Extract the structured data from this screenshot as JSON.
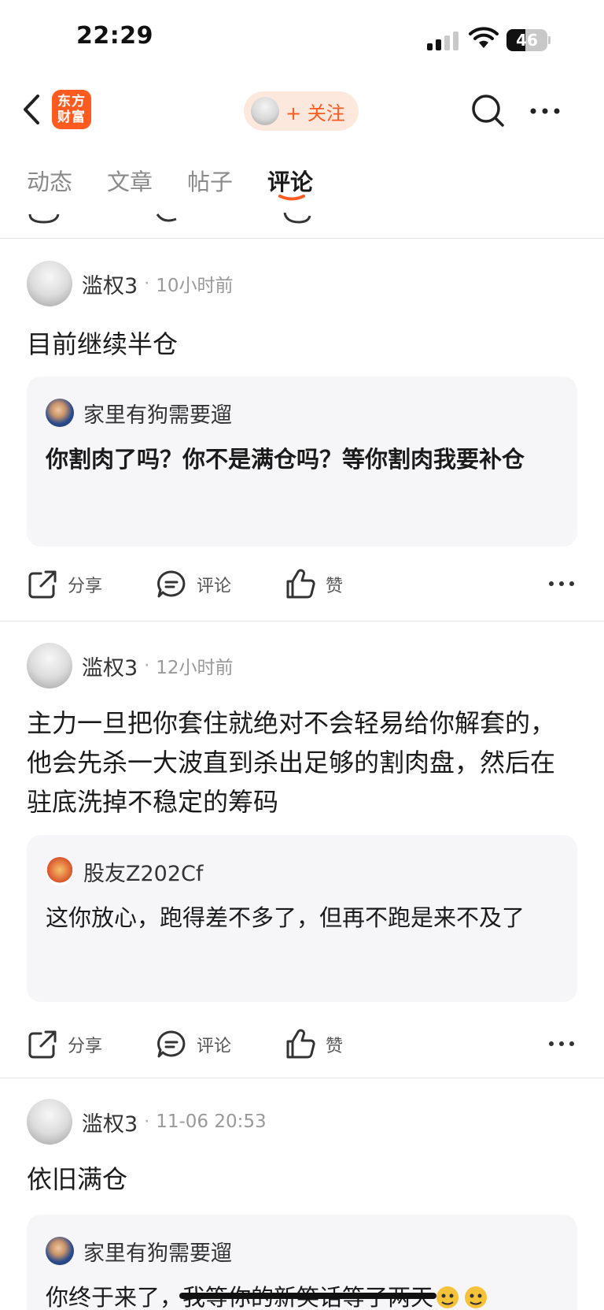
{
  "status_bar": {
    "time": "22:29",
    "battery_level": "46",
    "icons": [
      "signal-icon",
      "wifi-icon",
      "battery-icon"
    ]
  },
  "nav": {
    "back_icon": "chevron-left-icon",
    "logo_text": "东方财富",
    "follow_label": "+ 关注",
    "search_icon": "search-icon",
    "more_icon": "more-horizontal-icon"
  },
  "tabs": [
    {
      "label": "动态",
      "active": false
    },
    {
      "label": "文章",
      "active": false
    },
    {
      "label": "帖子",
      "active": false
    },
    {
      "label": "评论",
      "active": true
    }
  ],
  "colors": {
    "accent": "#ff5a1f",
    "follow_bg": "#fde8de",
    "quote_bg": "#f6f6f8",
    "divider": "#e6e6e6"
  },
  "posts": [
    {
      "author": "滥权3",
      "time": "10小时前",
      "body": "目前继续半仓",
      "quote": {
        "author": "家里有狗需要遛",
        "text": "你割肉了吗？你不是满仓吗？等你割肉我要补仓"
      },
      "actions": {
        "share": "分享",
        "comment": "评论",
        "like": "赞"
      }
    },
    {
      "author": "滥权3",
      "time": "12小时前",
      "body": "主力一旦把你套住就绝对不会轻易给你解套的，他会先杀一大波直到杀出足够的割肉盘，然后在驻底洗掉不稳定的筹码",
      "quote": {
        "author": "股友Z202Cf",
        "text": "这你放心，跑得差不多了，但再不跑是来不及了"
      },
      "actions": {
        "share": "分享",
        "comment": "评论",
        "like": "赞"
      }
    },
    {
      "author": "滥权3",
      "time": "11-06 20:53",
      "body": "依旧满仓",
      "quote": {
        "author": "家里有狗需要遛",
        "text_plain": "你终于来了，",
        "text_struck": "我等你的新笑话等了两天",
        "emoji": "666-emoji"
      }
    }
  ]
}
